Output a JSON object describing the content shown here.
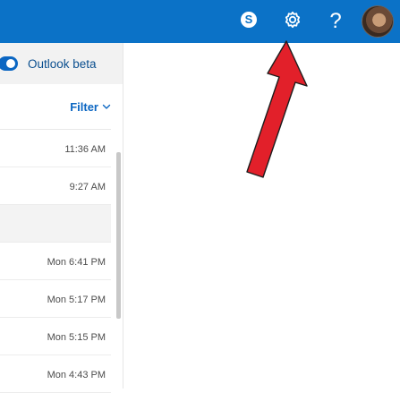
{
  "header": {
    "icons": {
      "skype": "skype-icon",
      "settings": "gear-icon",
      "help": "help-icon",
      "avatar": "avatar"
    },
    "help_symbol": "?",
    "background_color": "#0b72c7"
  },
  "toggle": {
    "label": "Outlook beta",
    "state": "on"
  },
  "filter": {
    "label": "Filter",
    "icon": "chevron-down-icon"
  },
  "messages": [
    {
      "time": "11:36 AM"
    },
    {
      "time": "9:27 AM"
    },
    {
      "time": "Mon 6:41 PM"
    },
    {
      "time": "Mon 5:17 PM"
    },
    {
      "time": "Mon 5:15 PM"
    },
    {
      "time": "Mon 4:43 PM"
    }
  ],
  "annotation": {
    "type": "arrow",
    "color": "#e2202a",
    "points_to": "settings-button"
  }
}
